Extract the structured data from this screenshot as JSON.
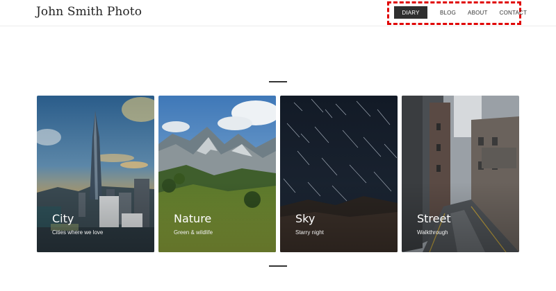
{
  "site": {
    "title": "John Smith Photo"
  },
  "nav": {
    "items": [
      {
        "label": "DIARY",
        "active": true
      },
      {
        "label": "BLOG",
        "active": false
      },
      {
        "label": "ABOUT",
        "active": false
      },
      {
        "label": "CONTACT",
        "active": false
      }
    ],
    "highlight_color": "#e00000"
  },
  "cards": [
    {
      "title": "City",
      "subtitle": "Cities where we love",
      "image": "city-skyline-photo"
    },
    {
      "title": "Nature",
      "subtitle": "Green & wildlife",
      "image": "mountain-landscape-photo"
    },
    {
      "title": "Sky",
      "subtitle": "Starry night",
      "image": "star-trails-photo"
    },
    {
      "title": "Street",
      "subtitle": "Walkthrough",
      "image": "alley-street-photo"
    }
  ],
  "colors": {
    "nav_active_bg": "#2f2f2f",
    "text": "#222222"
  }
}
